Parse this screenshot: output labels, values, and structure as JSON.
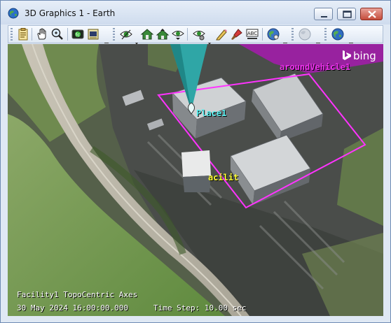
{
  "window": {
    "title": "3D Graphics 1 - Earth",
    "icon": "globe-icon"
  },
  "title_buttons": [
    "minimize-icon",
    "maximize-icon",
    "close-icon"
  ],
  "toolbar_icons": [
    "properties-icon",
    "pan-hand-icon",
    "zoom-icon",
    "view-from-to-icon",
    "home-view-icon",
    "visibility-eye-icon",
    "home-icon",
    "home-up-icon",
    "eye-down-icon",
    "settings-eye-icon",
    "pencil-icon",
    "brush-icon",
    "abc-labels-icon",
    "globe-icon",
    "globe-disabled-icon",
    "globe-earth-icon"
  ],
  "viewport": {
    "place_label": "Place1",
    "facility_label": "acilit",
    "vehicle_label": "aroundVehicle1",
    "bing_logo": "bing",
    "overlay_line1": "Facility1 TopoCentric Axes",
    "overlay_date": "30 May 2024 16:00:00.000",
    "overlay_timestep": "Time Step: 10.00 sec",
    "colors": {
      "place": "#59f0f0",
      "facility": "#ffff33",
      "vehicle": "#ee33ee",
      "region": "#ff33ff"
    }
  }
}
